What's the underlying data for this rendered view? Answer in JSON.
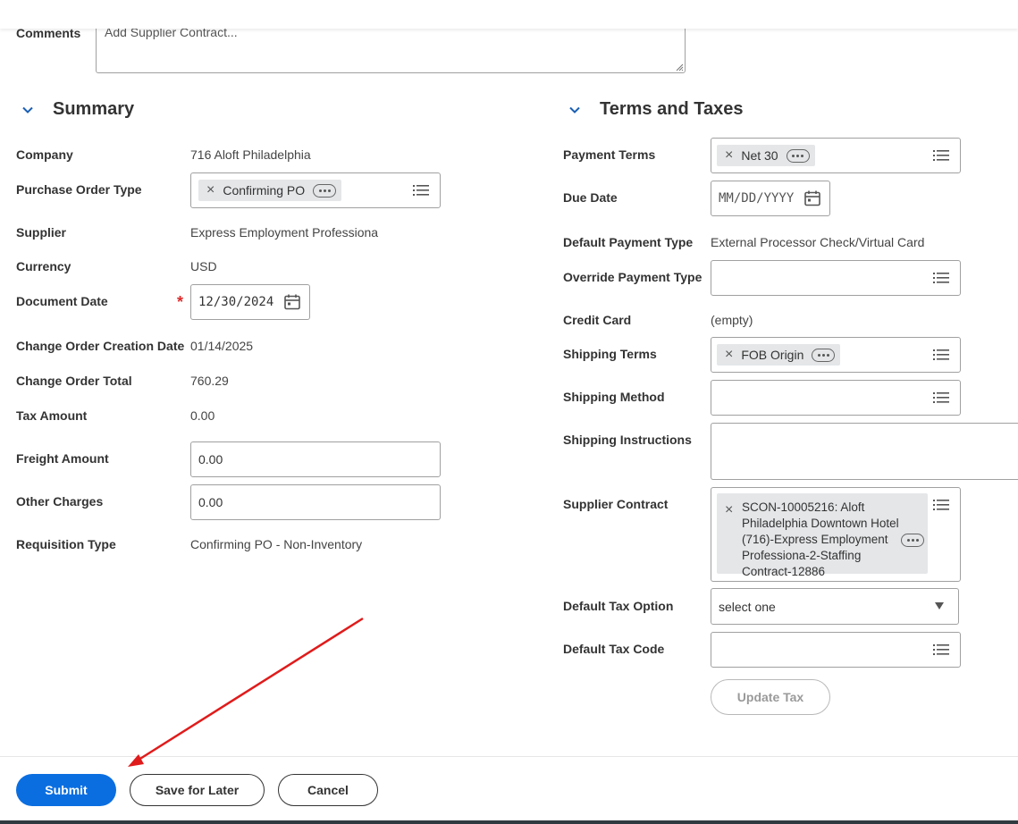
{
  "comments": {
    "label": "Comments",
    "placeholder": "Add Supplier Contract..."
  },
  "summary": {
    "title": "Summary",
    "company_label": "Company",
    "company_value": "716 Aloft Philadelphia",
    "po_type_label": "Purchase Order Type",
    "po_type_value": "Confirming PO",
    "supplier_label": "Supplier",
    "supplier_value": "Express Employment Professiona",
    "currency_label": "Currency",
    "currency_value": "USD",
    "doc_date_label": "Document Date",
    "doc_date_value": "12/30/2024",
    "required_mark": "*",
    "change_order_date_label": "Change Order Creation Date",
    "change_order_date_value": "01/14/2025",
    "change_order_total_label": "Change Order Total",
    "change_order_total_value": "760.29",
    "tax_amount_label": "Tax Amount",
    "tax_amount_value": "0.00",
    "freight_label": "Freight Amount",
    "freight_value": "0.00",
    "other_charges_label": "Other Charges",
    "other_charges_value": "0.00",
    "requisition_type_label": "Requisition Type",
    "requisition_type_value": "Confirming PO - Non-Inventory"
  },
  "terms": {
    "title": "Terms and Taxes",
    "payment_terms_label": "Payment Terms",
    "payment_terms_value": "Net 30",
    "due_date_label": "Due Date",
    "due_date_placeholder": "MM/DD/YYYY",
    "default_payment_type_label": "Default Payment Type",
    "default_payment_type_value": "External Processor Check/Virtual Card",
    "override_payment_type_label": "Override Payment Type",
    "credit_card_label": "Credit Card",
    "credit_card_value": "(empty)",
    "shipping_terms_label": "Shipping Terms",
    "shipping_terms_value": "FOB Origin",
    "shipping_method_label": "Shipping Method",
    "shipping_instructions_label": "Shipping Instructions",
    "supplier_contract_label": "Supplier Contract",
    "supplier_contract_value": "SCON-10005216: Aloft Philadelphia Downtown Hotel (716)-Express Employment Professiona-2-Staffing Contract-12886",
    "default_tax_option_label": "Default Tax Option",
    "default_tax_option_value": "select one",
    "default_tax_code_label": "Default Tax Code",
    "update_tax_label": "Update Tax"
  },
  "footer": {
    "submit_label": "Submit",
    "save_later_label": "Save for Later",
    "cancel_label": "Cancel"
  },
  "icons": {
    "pill_remove": "close-icon",
    "pill_more": "more-options-icon",
    "prompt": "list-icon",
    "calendar": "calendar-icon",
    "collapse": "chevron-down-icon"
  },
  "colors": {
    "primary": "#0b6ee0",
    "required": "#de2a2a",
    "annotation_arrow": "#e01b1b"
  }
}
